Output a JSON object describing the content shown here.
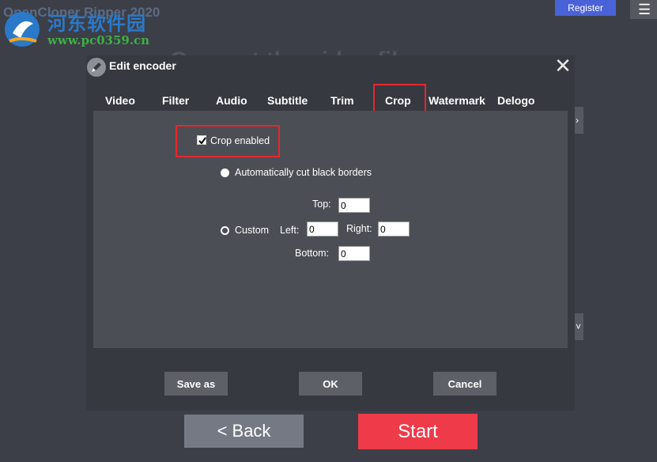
{
  "app": {
    "title": "OpenCloner Ripper 2020",
    "register_label": "Register",
    "menu_icon": "☰",
    "bg_heading": "Convert the video files"
  },
  "watermark": {
    "site_name": "河东软件园",
    "url": "www.pc0359.cn"
  },
  "dialog": {
    "title": "Edit encoder",
    "close_glyph": "✕",
    "tabs": [
      {
        "label": "Video"
      },
      {
        "label": "Filter"
      },
      {
        "label": "Audio"
      },
      {
        "label": "Subtitle"
      },
      {
        "label": "Trim"
      },
      {
        "label": "Crop",
        "active": true
      },
      {
        "label": "Watermark"
      },
      {
        "label": "Delogo"
      }
    ],
    "crop": {
      "enabled_label": "Crop enabled",
      "enabled": true,
      "auto_label": "Automatically cut black borders",
      "custom_label": "Custom",
      "top_label": "Top:",
      "left_label": "Left:",
      "right_label": "Right:",
      "bottom_label": "Bottom:",
      "top": "0",
      "left": "0",
      "right": "0",
      "bottom": "0"
    },
    "buttons": {
      "save_as": "Save as",
      "ok": "OK",
      "cancel": "Cancel"
    }
  },
  "footer": {
    "back_label": "<  Back",
    "start_label": "Start"
  },
  "colors": {
    "background": "#3c3f47",
    "dialog": "#363940",
    "panel": "#4b4e55",
    "highlight": "#e8262b",
    "start": "#ef3a4a",
    "register": "#4a62d8"
  }
}
